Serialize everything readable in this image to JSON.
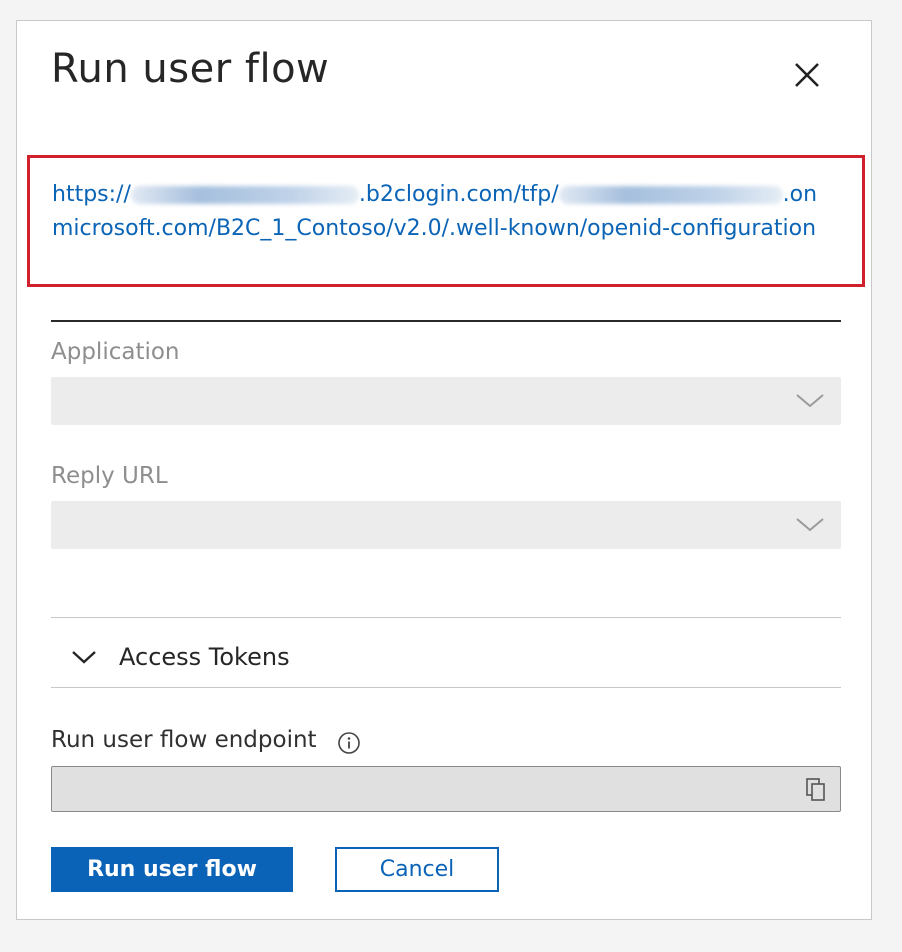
{
  "dialog": {
    "title": "Run user flow",
    "close_icon": "close-icon"
  },
  "metadata_url": {
    "part1": "https://",
    "part2": ".b2clogin.com/tfp/",
    "part3": ".on microsoft.com/B2C_1_Contoso/v2.0/.well-known/openid-configuration",
    "highlight_color": "#d0202e",
    "link_color": "#0b64b5"
  },
  "application": {
    "label": "Application",
    "value": ""
  },
  "reply_url": {
    "label": "Reply URL",
    "value": ""
  },
  "access_tokens": {
    "label": "Access Tokens",
    "icon": "chevron-down-icon"
  },
  "endpoint": {
    "label": "Run user flow endpoint",
    "info_icon": "info-icon",
    "value": "",
    "copy_icon": "copy-icon"
  },
  "actions": {
    "run_label": "Run user flow",
    "cancel_label": "Cancel",
    "accent": "#0b63b7"
  }
}
